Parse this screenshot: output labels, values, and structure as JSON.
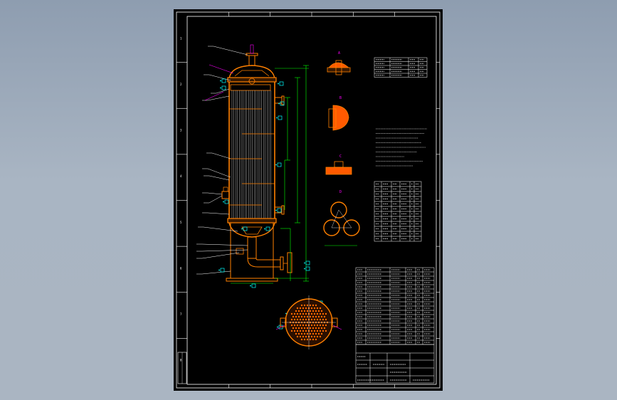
{
  "drawing": {
    "background": "#000000",
    "colors": {
      "frame": "#ffffff",
      "vessel": "#ff8000",
      "dimension": "#00ff00",
      "callout": "#00ffff",
      "tube": "#c8c8c8",
      "accent": "#ff00ff",
      "hatch": "#ff5a00"
    },
    "border_row_labels": [
      "1",
      "2",
      "3",
      "4",
      "5",
      "6",
      "7",
      "8"
    ],
    "tables": {
      "top_right": {
        "rows": 5,
        "columns": 4
      },
      "middle_right": {
        "rows": 12,
        "columns": 6
      },
      "bottom_right": {
        "rows": 18,
        "columns": 6
      }
    },
    "title_block": {
      "drawing_number": "",
      "title": ""
    }
  }
}
